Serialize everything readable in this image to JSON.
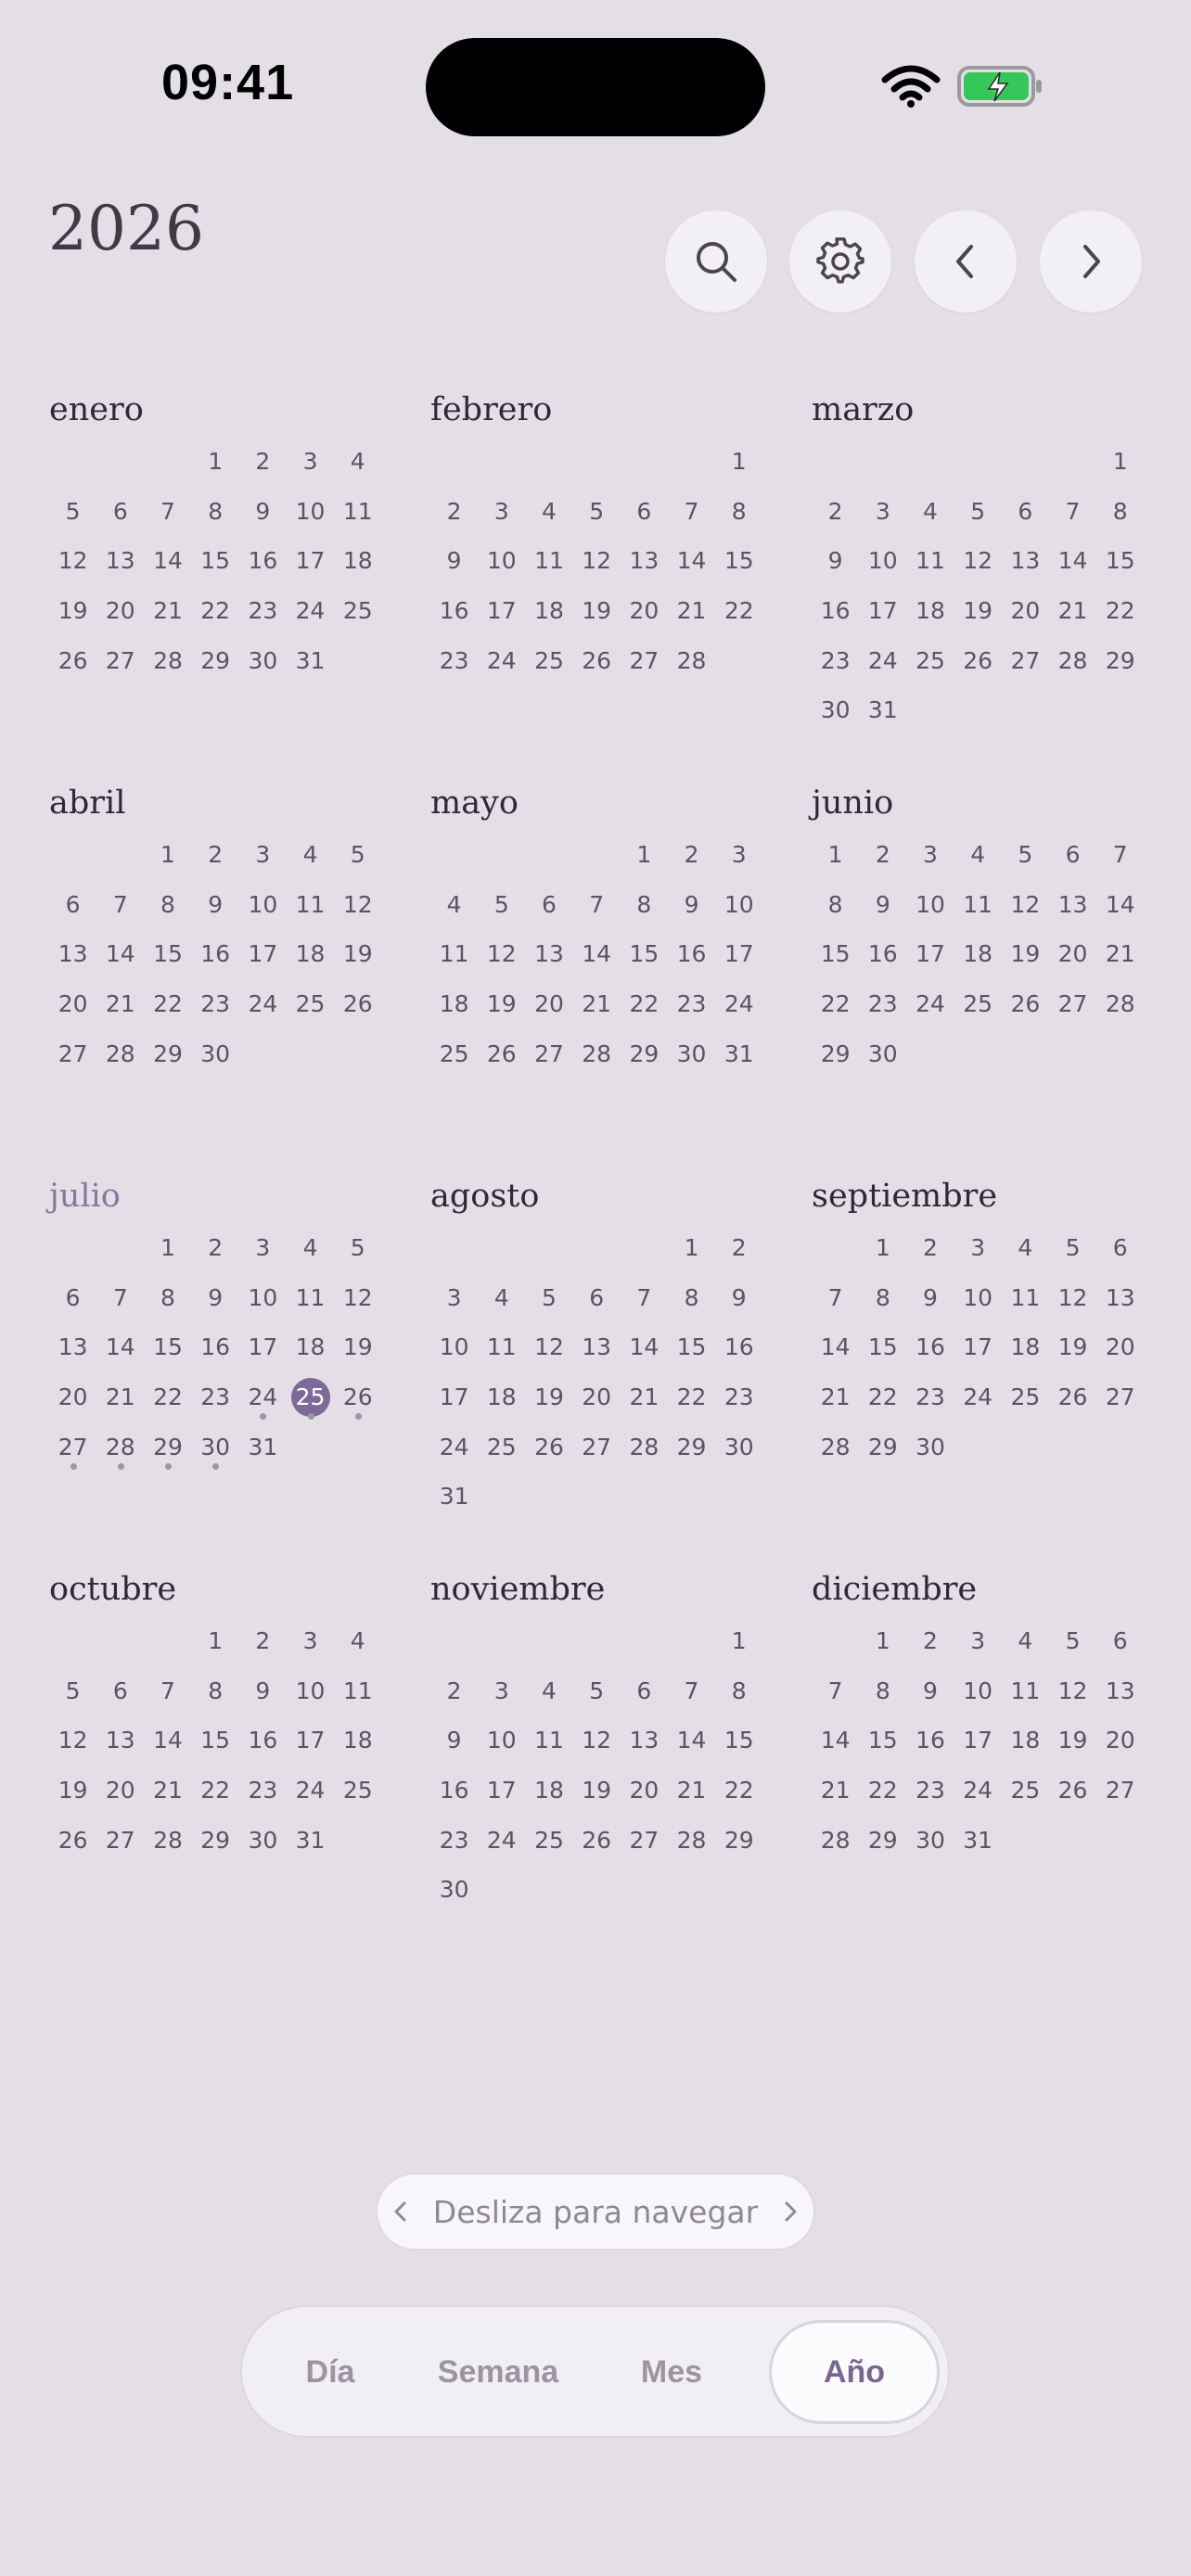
{
  "status_bar": {
    "time": "09:41"
  },
  "header": {
    "year": "2026",
    "buttons": [
      "search-icon",
      "gear-icon",
      "chevron-left-icon",
      "chevron-right-icon"
    ]
  },
  "months": [
    {
      "name": "enero",
      "offset": 3,
      "days": 31,
      "current": false,
      "today": null,
      "events": []
    },
    {
      "name": "febrero",
      "offset": 6,
      "days": 28,
      "current": false,
      "today": null,
      "events": []
    },
    {
      "name": "marzo",
      "offset": 6,
      "days": 31,
      "current": false,
      "today": null,
      "events": []
    },
    {
      "name": "abril",
      "offset": 2,
      "days": 30,
      "current": false,
      "today": null,
      "events": []
    },
    {
      "name": "mayo",
      "offset": 4,
      "days": 31,
      "current": false,
      "today": null,
      "events": []
    },
    {
      "name": "junio",
      "offset": 0,
      "days": 30,
      "current": false,
      "today": null,
      "events": []
    },
    {
      "name": "julio",
      "offset": 2,
      "days": 31,
      "current": true,
      "today": 25,
      "events": [
        24,
        25,
        26,
        27,
        28,
        29,
        30
      ]
    },
    {
      "name": "agosto",
      "offset": 5,
      "days": 31,
      "current": false,
      "today": null,
      "events": []
    },
    {
      "name": "septiembre",
      "offset": 1,
      "days": 30,
      "current": false,
      "today": null,
      "events": []
    },
    {
      "name": "octubre",
      "offset": 3,
      "days": 31,
      "current": false,
      "today": null,
      "events": []
    },
    {
      "name": "noviembre",
      "offset": 6,
      "days": 30,
      "current": false,
      "today": null,
      "events": []
    },
    {
      "name": "diciembre",
      "offset": 1,
      "days": 31,
      "current": false,
      "today": null,
      "events": []
    }
  ],
  "hint": {
    "label": "Desliza para navegar"
  },
  "view_switcher": {
    "items": [
      "Día",
      "Semana",
      "Mes",
      "Año"
    ],
    "active": "Año"
  },
  "colors": {
    "background": "#e4dfe7",
    "accent": "#7e6a98",
    "current_month": "#8a769f",
    "battery_fill": "#35c759"
  }
}
